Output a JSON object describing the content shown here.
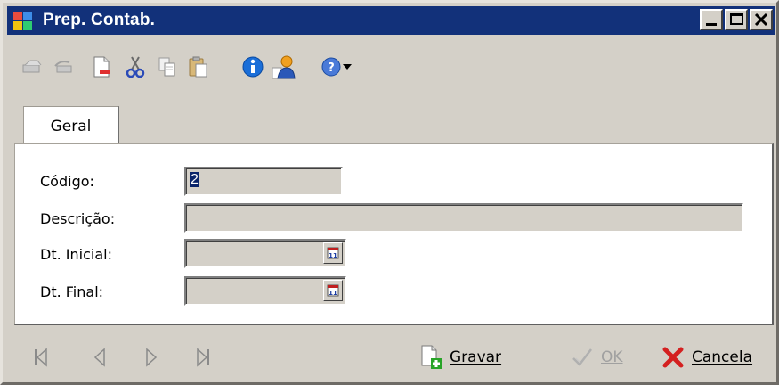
{
  "window": {
    "title": "Prep. Contab.",
    "minimize_glyph": "_",
    "close_glyph": "✕"
  },
  "toolbar": {
    "icons": [
      "first-record-icon",
      "prev-record-icon",
      "new-document-icon",
      "cut-icon",
      "copy-icon",
      "paste-icon",
      "info-icon",
      "user-icon",
      "help-icon",
      "dropdown-arrow-icon"
    ]
  },
  "tabs": [
    {
      "label": "Geral",
      "selected": true
    }
  ],
  "form": {
    "codigo_label": "Código:",
    "codigo_value": "2",
    "descricao_label": "Descrição:",
    "descricao_value": "",
    "dt_inicial_label": "Dt. Inicial:",
    "dt_inicial_value": "",
    "dt_final_label": "Dt. Final:",
    "dt_final_value": "",
    "calendar_glyph": "11"
  },
  "actions": {
    "gravar": "Gravar",
    "ok": "OK",
    "cancela": "Cancela"
  },
  "colors": {
    "title_bar": "#12317a",
    "window_face": "#d4d0c8",
    "selection": "#0a246a",
    "cancel_red": "#d42020",
    "info_blue": "#1a6ed8"
  }
}
